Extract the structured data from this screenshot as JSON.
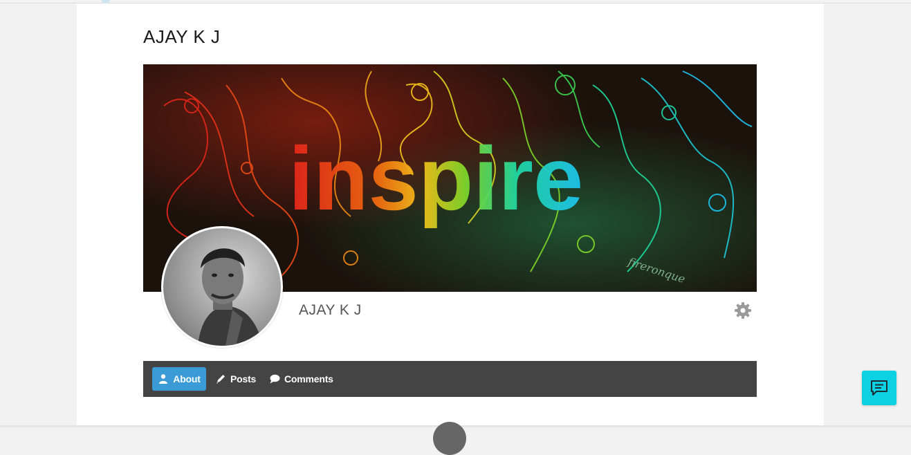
{
  "profile": {
    "page_title": "AJAY K J",
    "display_name": "AJAY K J",
    "cover_text": "inspire",
    "cover_signature": "fireronque"
  },
  "tabs": [
    {
      "label": "About",
      "icon": "user-icon",
      "active": true
    },
    {
      "label": "Posts",
      "icon": "pencil-icon",
      "active": false
    },
    {
      "label": "Comments",
      "icon": "comment-icon",
      "active": false
    }
  ],
  "colors": {
    "nav_bg": "#444444",
    "active_tab": "#3b9bd6",
    "chat_button": "#0bd1e3",
    "gear": "#9a9a9a"
  },
  "icons": {
    "settings": "gear-icon",
    "chat": "chat-icon"
  }
}
